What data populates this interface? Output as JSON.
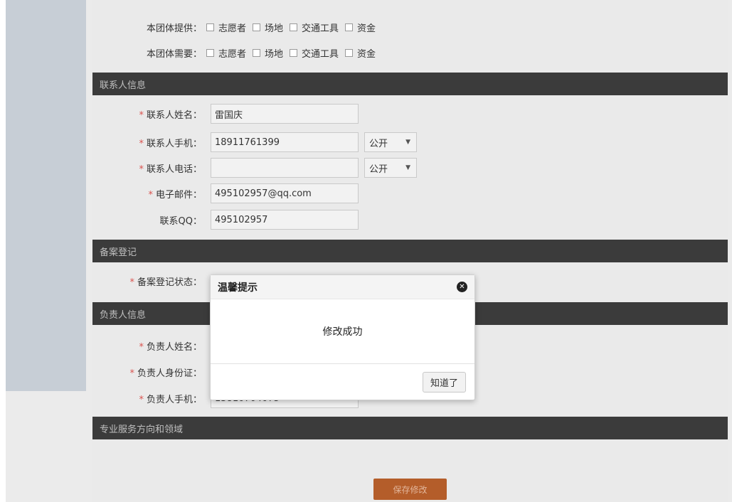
{
  "provide": {
    "label": "本团体提供：",
    "options": [
      "志愿者",
      "场地",
      "交通工具",
      "资金"
    ]
  },
  "need": {
    "label": "本团体需要：",
    "options": [
      "志愿者",
      "场地",
      "交通工具",
      "资金"
    ]
  },
  "sections": {
    "contact": "联系人信息",
    "record": "备案登记",
    "principal": "负责人信息",
    "service": "专业服务方向和领域"
  },
  "contact": {
    "name_label": "联系人姓名：",
    "name_value": "雷国庆",
    "mobile_label": "联系人手机：",
    "mobile_value": "18911761399",
    "mobile_visibility": "公开",
    "phone_label": "联系人电话：",
    "phone_value": "",
    "phone_visibility": "公开",
    "email_label": "电子邮件：",
    "email_value": "495102957@qq.com",
    "qq_label": "联系QQ：",
    "qq_value": "495102957"
  },
  "record": {
    "status_label": "备案登记状态："
  },
  "principal": {
    "name_label": "负责人姓名：",
    "id_label": "负责人身份证：",
    "mobile_label": "负责人手机：",
    "mobile_value_partial": "13810704075"
  },
  "required_mark": "*",
  "modal": {
    "title": "温馨提示",
    "message": "修改成功",
    "ok_label": "知道了",
    "close_icon": "close-icon"
  },
  "save_label": "保存修改",
  "colors": {
    "section_bg": "#3b3b3b",
    "save_bg": "#b45d2a",
    "sidebar": "#c7ced6",
    "required": "#d9534f"
  }
}
